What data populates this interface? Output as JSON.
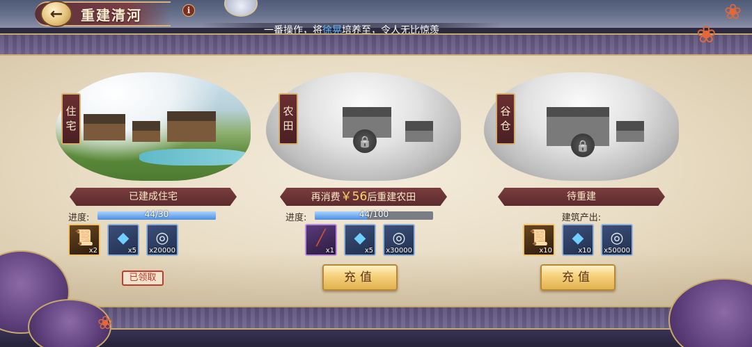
{
  "header": {
    "title": "重建清河",
    "back_icon": "back-arrow-icon",
    "info_icon": "info-icon",
    "info_glyph": "i"
  },
  "ticker": {
    "part1": "一番操作，将",
    "name": "徐晃",
    "part2": "培养至",
    "rank": "",
    "part3": "，令人无比惊羡"
  },
  "cards": [
    {
      "label": "住宅",
      "status": "已建成住宅",
      "progress_label": "进度:",
      "progress_text": "44/30",
      "progress_ratio": 1.0,
      "rewards": [
        {
          "icon": "scroll-icon",
          "count": "x2",
          "rarity": "gold"
        },
        {
          "icon": "crystal-icon",
          "count": "x5",
          "rarity": "blue"
        },
        {
          "icon": "coin-icon",
          "count": "x20000",
          "rarity": "blue"
        }
      ],
      "action": "已领取"
    },
    {
      "label": "农田",
      "status_prefix": "再消费",
      "status_amount": "￥56",
      "status_suffix": "后重建农田",
      "progress_label": "进度:",
      "progress_text": "44/100",
      "progress_ratio": 0.44,
      "rewards": [
        {
          "icon": "spear-icon",
          "count": "x1",
          "rarity": "purple"
        },
        {
          "icon": "crystal-icon",
          "count": "x5",
          "rarity": "blue"
        },
        {
          "icon": "coin-icon",
          "count": "x30000",
          "rarity": "blue"
        }
      ],
      "action": "充值"
    },
    {
      "label": "谷仓",
      "status": "待重建",
      "output_label": "建筑产出:",
      "rewards": [
        {
          "icon": "scroll-icon",
          "count": "x10",
          "rarity": "gold"
        },
        {
          "icon": "crystal-icon",
          "count": "x10",
          "rarity": "blue"
        },
        {
          "icon": "coin-icon",
          "count": "x50000",
          "rarity": "blue"
        }
      ],
      "action": "充值"
    }
  ],
  "colors": {
    "accent_gold": "#e2b250",
    "banner_red": "#5c2b2e",
    "progress_blue": "#4d8ee0",
    "name_blue": "#5fb8ff",
    "rank_red": "#e05030"
  }
}
